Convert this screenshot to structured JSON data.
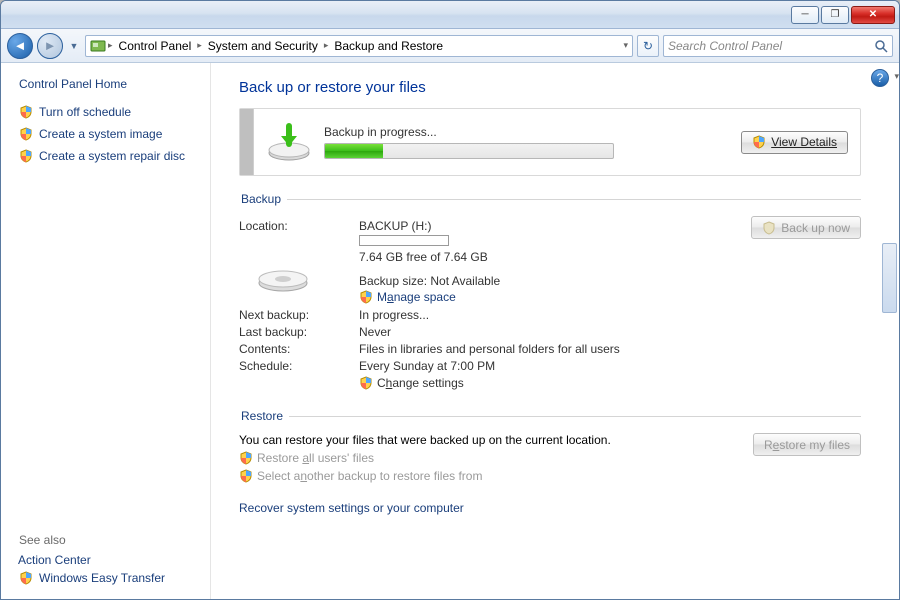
{
  "window_controls": {
    "min": "─",
    "max": "❐",
    "close": "✕"
  },
  "nav": {
    "back_glyph": "◄",
    "fwd_glyph": "►",
    "drop_glyph": "▼",
    "refresh_glyph": "↻"
  },
  "breadcrumb": {
    "items": [
      "Control Panel",
      "System and Security",
      "Backup and Restore"
    ]
  },
  "search": {
    "placeholder": "Search Control Panel"
  },
  "sidebar": {
    "home": "Control Panel Home",
    "links": [
      {
        "label": "Turn off schedule"
      },
      {
        "label": "Create a system image"
      },
      {
        "label": "Create a system repair disc"
      }
    ],
    "see_also": "See also",
    "action_center": "Action Center",
    "easy_transfer": "Windows Easy Transfer"
  },
  "page": {
    "title": "Back up or restore your files",
    "progress_label": "Backup in progress...",
    "view_details": "View Details",
    "progress_pct": 20
  },
  "backup": {
    "legend": "Backup",
    "location_lbl": "Location:",
    "location_val": "BACKUP (H:)",
    "free_space": "7.64 GB free of 7.64 GB",
    "size_line": "Backup size: Not Available",
    "manage_space_pre": "M",
    "manage_space_u": "a",
    "manage_space_post": "nage space",
    "backup_now": "Back up now",
    "rows": {
      "next_lbl": "Next backup:",
      "next_val": "In progress...",
      "last_lbl": "Last backup:",
      "last_val": "Never",
      "contents_lbl": "Contents:",
      "contents_val": "Files in libraries and personal folders for all users",
      "schedule_lbl": "Schedule:",
      "schedule_val": "Every Sunday at 7:00 PM"
    },
    "change_pre": "C",
    "change_u": "h",
    "change_post": "ange settings"
  },
  "restore": {
    "legend": "Restore",
    "intro": "You can restore your files that were backed up on the current location.",
    "restore_all_pre": "Restore ",
    "restore_all_u": "a",
    "restore_all_post": "ll users' files",
    "select_another_pre": "Select a",
    "select_another_u": "n",
    "select_another_post": "other backup to restore files from",
    "restore_my_files_pre": "R",
    "restore_my_files_u": "e",
    "restore_my_files_post": "store my files",
    "recover_link": "Recover system settings or your computer"
  },
  "help_glyph": "?"
}
